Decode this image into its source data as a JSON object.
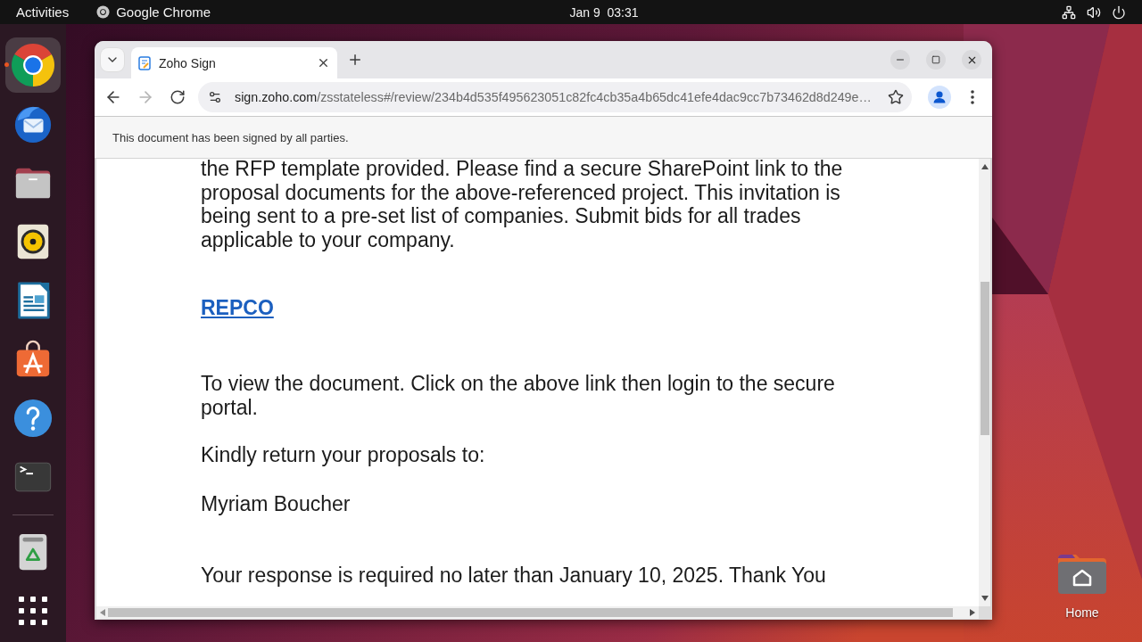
{
  "top_bar": {
    "activities": "Activities",
    "app_menu": "Google Chrome",
    "clock": "Jan 9  03:31"
  },
  "dock": {
    "items": [
      {
        "kind": "browser",
        "running": true,
        "focused": true
      },
      {
        "kind": "mail",
        "running": false,
        "focused": false
      },
      {
        "kind": "files",
        "running": false,
        "focused": false
      },
      {
        "kind": "music",
        "running": false,
        "focused": false
      },
      {
        "kind": "writer",
        "running": false,
        "focused": false
      },
      {
        "kind": "store",
        "running": false,
        "focused": false
      },
      {
        "kind": "help",
        "running": false,
        "focused": false
      },
      {
        "kind": "terminal",
        "running": false,
        "focused": false
      },
      {
        "kind": "trash",
        "running": false,
        "focused": false
      }
    ]
  },
  "browser": {
    "tabs": [
      {
        "title": "Zoho Sign",
        "selected": true
      }
    ],
    "nav_buttons": [
      {
        "kind": "back",
        "disabled": false
      },
      {
        "kind": "forward",
        "disabled": true
      },
      {
        "kind": "reload",
        "disabled": false
      }
    ],
    "address": {
      "host": "sign.zoho.com",
      "path": "/zsstateless#/review/234b4d535f495623051c82fc4cb35a4b65dc41efe4dac9cc7b73462d8d249e…"
    },
    "info_bar": "This document has been signed by all parties.",
    "document": {
      "blocks": [
        {
          "kind": "paragraph",
          "text": "the RFP template provided. Please find a secure SharePoint link to the proposal documents for the above-referenced project. This invitation is being sent to a pre-set list of companies. Submit bids for all trades applicable to your company."
        },
        {
          "kind": "link",
          "text": "REPCO"
        },
        {
          "kind": "paragraph",
          "text": "To view the document. Click on the above link then login to the secure portal."
        },
        {
          "kind": "paragraph",
          "text": "Kindly return your proposals to:"
        },
        {
          "kind": "paragraph",
          "text": "Myriam Boucher"
        },
        {
          "kind": "paragraph",
          "text": "Your response is required no later than January 10, 2025. Thank You"
        }
      ]
    }
  },
  "desktop_icons": [
    {
      "label": "Home"
    }
  ]
}
